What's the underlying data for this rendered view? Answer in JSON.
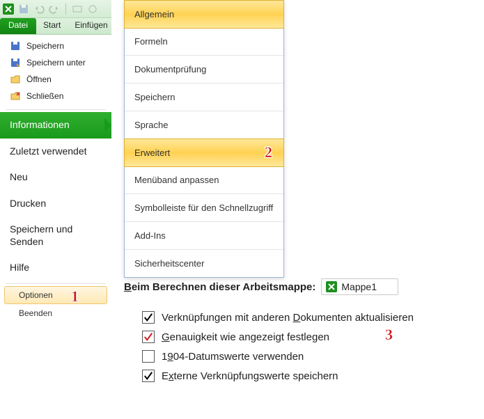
{
  "qat": {
    "icons": [
      "excel-logo",
      "save",
      "undo",
      "redo",
      "print",
      "touch"
    ]
  },
  "ribbon": {
    "file": "Datei",
    "tabs": [
      "Start",
      "Einfügen"
    ]
  },
  "backstage": {
    "top_items": [
      {
        "icon": "save",
        "label": "Speichern"
      },
      {
        "icon": "saveas",
        "label": "Speichern unter"
      },
      {
        "icon": "open",
        "label": "Öffnen"
      },
      {
        "icon": "close",
        "label": "Schließen"
      }
    ],
    "info": "Informationen",
    "big_items": [
      "Zuletzt verwendet",
      "Neu",
      "Drucken",
      "Speichern und Senden",
      "Hilfe"
    ],
    "footer": [
      {
        "icon": "options",
        "label": "Optionen",
        "selected": true
      },
      {
        "icon": "exit",
        "label": "Beenden",
        "selected": false
      }
    ]
  },
  "option_categories": [
    {
      "label": "Allgemein",
      "selected": true
    },
    {
      "label": "Formeln"
    },
    {
      "label": "Dokumentprüfung"
    },
    {
      "label": "Speichern"
    },
    {
      "label": "Sprache"
    },
    {
      "label": "Erweitert",
      "selected": true,
      "annot": "2"
    },
    {
      "label": "Menüband anpassen"
    },
    {
      "label": "Symbolleiste für den Schnellzugriff"
    },
    {
      "label": "Add-Ins"
    },
    {
      "label": "Sicherheitscenter"
    }
  ],
  "calc": {
    "title_pre": "B",
    "title_rest": "eim Berechnen dieser Arbeitsmappe:",
    "workbook": "Mappe1",
    "rows": [
      {
        "checked": true,
        "color": "#000",
        "pre": "Verknüpfungen mit anderen ",
        "ul": "D",
        "post": "okumenten aktualisieren"
      },
      {
        "checked": true,
        "color": "#d01818",
        "red": true,
        "pre": "",
        "ul": "G",
        "post": "enauigkeit wie angezeigt festlegen",
        "annot": "3"
      },
      {
        "checked": false,
        "color": "#000",
        "pre": "1",
        "ul": "9",
        "post": "04-Datumswerte verwenden"
      },
      {
        "checked": true,
        "color": "#000",
        "pre": "E",
        "ul": "x",
        "post": "terne Verknüpfungswerte speichern"
      }
    ]
  },
  "annotations": {
    "a1": "1"
  }
}
